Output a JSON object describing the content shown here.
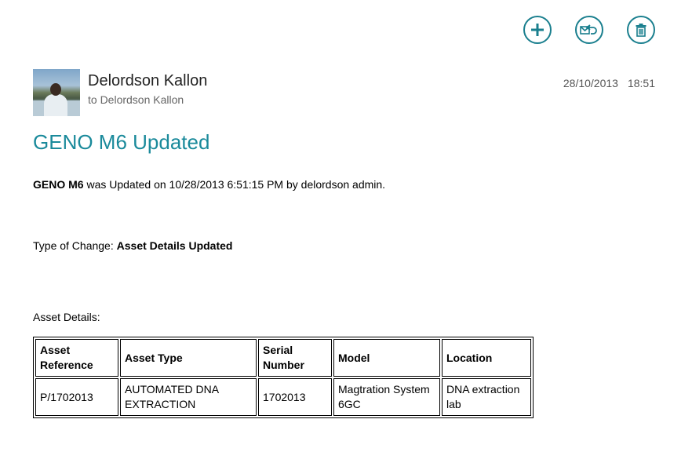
{
  "toolbar": {
    "icons": [
      "plus-icon",
      "reply-icon",
      "trash-icon"
    ],
    "accent_color": "#1a7f8e"
  },
  "email": {
    "sender": "Delordson Kallon",
    "recipient_line": "to Delordson Kallon",
    "date": "28/10/2013",
    "time": "18:51",
    "subject": "GENO M6 Updated",
    "subject_color": "#1a8a9b",
    "body": {
      "line1_bold": "GENO M6",
      "line1_rest": " was Updated on 10/28/2013 6:51:15 PM by delordson admin.",
      "change_label": "Type of Change: ",
      "change_value": "Asset Details Updated",
      "details_label": "Asset Details:"
    },
    "table": {
      "headers": [
        "Asset Reference",
        "Asset Type",
        "Serial Number",
        "Model",
        "Location"
      ],
      "rows": [
        [
          "P/1702013",
          "AUTOMATED DNA EXTRACTION",
          "1702013",
          "Magtration System 6GC",
          "DNA extraction lab"
        ]
      ]
    }
  }
}
